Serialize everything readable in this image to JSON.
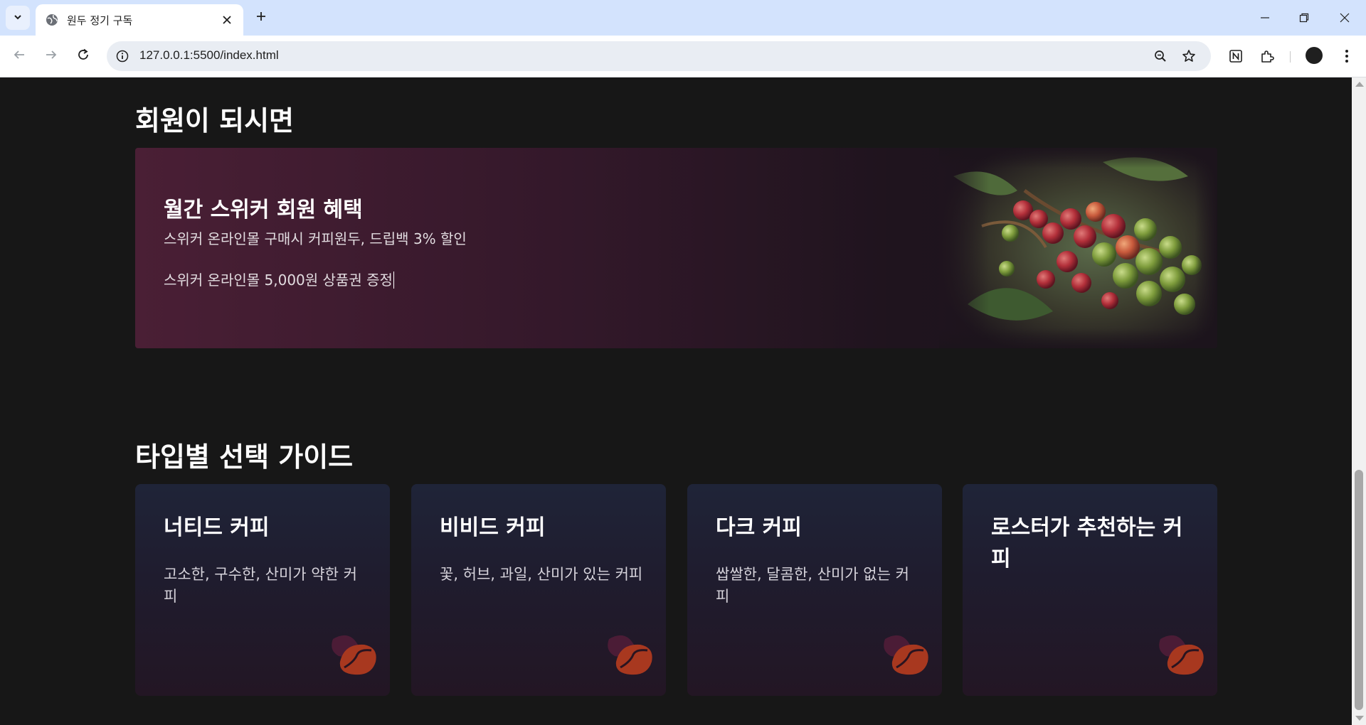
{
  "browser": {
    "tab_title": "원두 정기 구독",
    "url": "127.0.0.1:5500/index.html"
  },
  "membership": {
    "section_title": "회원이 되시면",
    "card_title": "월간 스위커 회원 혜택",
    "benefits": [
      "스위커 온라인몰 구매시 커피원두, 드립백 3% 할인",
      "스위커 온라인몰 5,000원 상품권 증정"
    ]
  },
  "guide": {
    "section_title": "타입별 선택 가이드",
    "cards": [
      {
        "title": "너티드 커피",
        "description": "고소한, 구수한, 산미가 약한 커피"
      },
      {
        "title": "비비드 커피",
        "description": "꽃, 허브, 과일, 산미가 있는 커피"
      },
      {
        "title": "다크 커피",
        "description": "쌉쌀한, 달콤한, 산미가 없는 커피"
      },
      {
        "title": "로스터가 추천하는 커피",
        "description": ""
      }
    ]
  },
  "colors": {
    "page_bg": "#171717",
    "benefit_gradient_start": "#4a1f35",
    "guide_card_top": "#1f2438",
    "bean_purple": "#4b1c36",
    "bean_orange": "#a8381f"
  }
}
